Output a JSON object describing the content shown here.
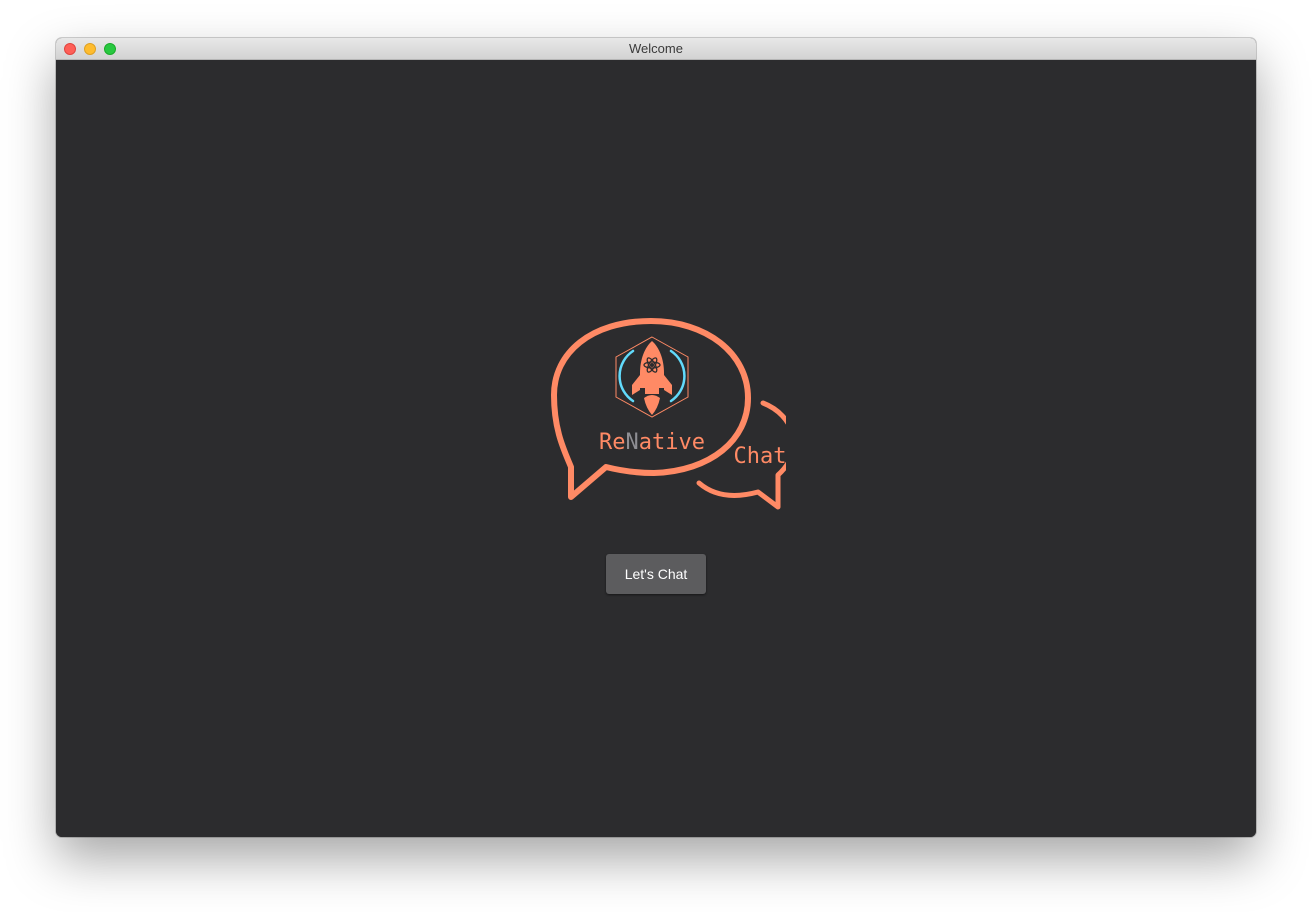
{
  "window": {
    "title": "Welcome"
  },
  "logo": {
    "word_re": "Re",
    "word_n": "N",
    "word_ative": "ative",
    "word_chat": "Chat",
    "accent_color": "#ff8a65",
    "react_color": "#61dafb",
    "muted_color": "#8e8e93"
  },
  "main": {
    "button_label": "Let's Chat"
  }
}
